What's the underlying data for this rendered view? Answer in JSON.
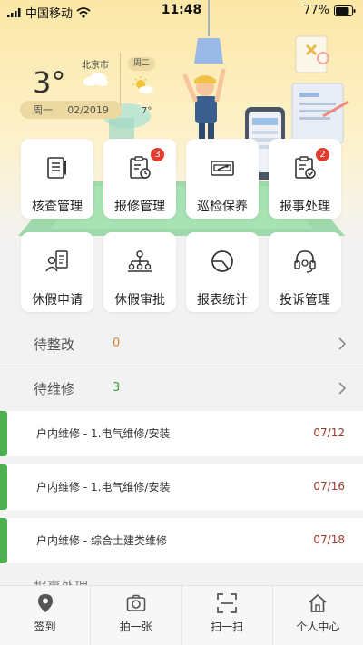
{
  "status_bar": {
    "carrier": "中国移动",
    "time": "11:48",
    "battery": "77%"
  },
  "weather": {
    "city": "北京市",
    "temperature": "3°",
    "weekday": "周一",
    "date": "02/2019",
    "next_day": "周二",
    "next_temp": "7°",
    "today_icon": "cloud-icon",
    "next_icon": "sun-cloud-icon"
  },
  "tiles": [
    {
      "label": "核查管理",
      "icon": "checklist-icon",
      "badge": ""
    },
    {
      "label": "报修管理",
      "icon": "clipboard-clock-icon",
      "badge": "3"
    },
    {
      "label": "巡检保养",
      "icon": "maintenance-icon",
      "badge": ""
    },
    {
      "label": "报事处理",
      "icon": "clipboard-check-icon",
      "badge": "2"
    },
    {
      "label": "休假申请",
      "icon": "leave-request-icon",
      "badge": ""
    },
    {
      "label": "休假审批",
      "icon": "org-chart-icon",
      "badge": ""
    },
    {
      "label": "报表统计",
      "icon": "pie-chart-icon",
      "badge": ""
    },
    {
      "label": "投诉管理",
      "icon": "headset-icon",
      "badge": ""
    }
  ],
  "sections": {
    "pending_rectify": {
      "label": "待整改",
      "count": "0"
    },
    "pending_repair": {
      "label": "待维修",
      "count": "3"
    }
  },
  "tasks": [
    {
      "title": "户内维修 - 1.电气维修/安装",
      "date": "07/12"
    },
    {
      "title": "户内维修 - 1.电气维修/安装",
      "date": "07/16"
    },
    {
      "title": "户内维修 - 综合土建类维修",
      "date": "07/18"
    }
  ],
  "next_section_peek": "报事处理",
  "tabbar": [
    {
      "label": "签到",
      "icon": "location-pin-icon"
    },
    {
      "label": "拍一张",
      "icon": "camera-icon"
    },
    {
      "label": "扫一扫",
      "icon": "scan-icon"
    },
    {
      "label": "个人中心",
      "icon": "home-icon"
    }
  ],
  "colors": {
    "accent_green": "#4caf50",
    "badge_red": "#e53b2f",
    "date_red": "#9c3a2c",
    "count_orange": "#d9822b",
    "count_green": "#3f9c3f",
    "hero_yellow": "#fbe7a6"
  }
}
